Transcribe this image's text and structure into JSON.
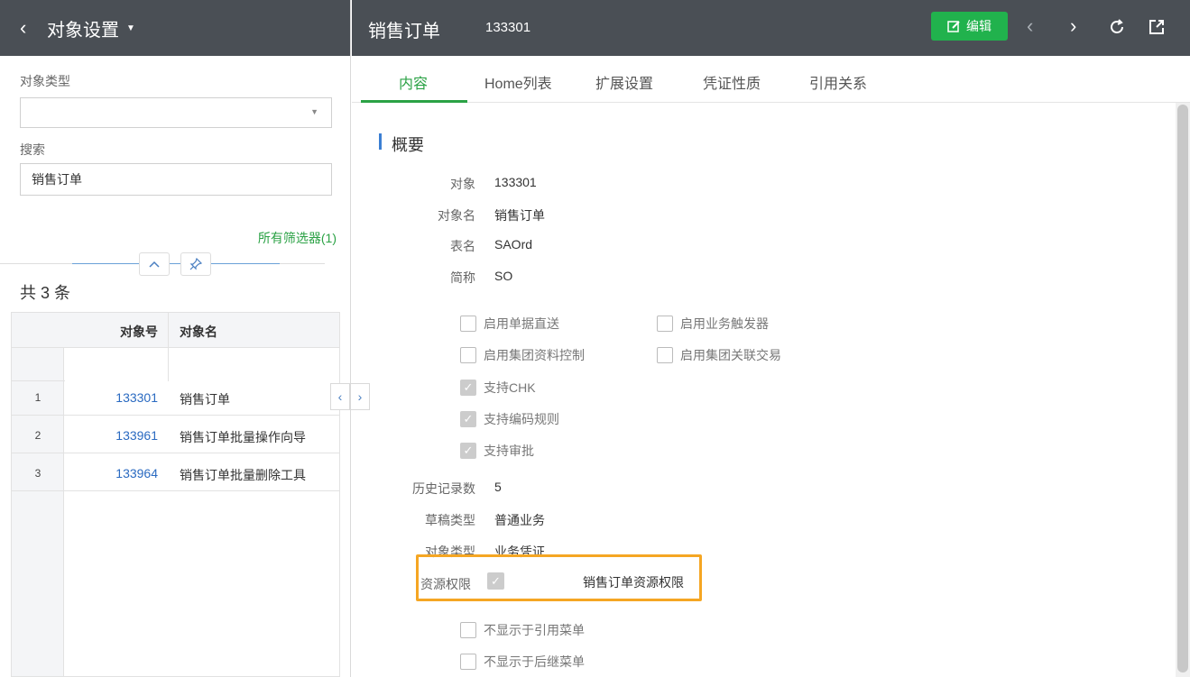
{
  "left": {
    "header_title": "对象设置",
    "object_type_label": "对象类型",
    "object_type_value": "",
    "search_label": "搜索",
    "search_value": "销售订单",
    "filters_link": "所有筛选器(1)",
    "count_text": "共 3 条",
    "grid": {
      "col_code": "对象号",
      "col_name": "对象名",
      "rows": [
        {
          "idx": "1",
          "code": "133301",
          "name": "销售订单"
        },
        {
          "idx": "2",
          "code": "133961",
          "name": "销售订单批量操作向导"
        },
        {
          "idx": "3",
          "code": "133964",
          "name": "销售订单批量删除工具"
        }
      ]
    }
  },
  "right": {
    "title": "销售订单",
    "number": "133301",
    "edit_label": "编辑",
    "tabs": [
      "内容",
      "Home列表",
      "扩展设置",
      "凭证性质",
      "引用关系"
    ],
    "section_title": "概要",
    "fields": {
      "object_label": "对象",
      "object_value": "133301",
      "object_name_label": "对象名",
      "object_name_value": "销售订单",
      "table_label": "表名",
      "table_value": "SAOrd",
      "abbr_label": "简称",
      "abbr_value": "SO"
    },
    "checkboxes": {
      "doc_direct": "启用单据直送",
      "biz_trigger": "启用业务触发器",
      "group_data_ctrl": "启用集团资料控制",
      "group_related": "启用集团关联交易",
      "support_chk": "支持CHK",
      "support_code_rule": "支持编码规则",
      "support_approval": "支持审批",
      "hide_ref_menu": "不显示于引用菜单",
      "hide_next_menu": "不显示于后继菜单"
    },
    "fields2": {
      "history_label": "历史记录数",
      "history_value": "5",
      "draft_label": "草稿类型",
      "draft_value": "普通业务",
      "objtype_label": "对象类型",
      "objtype_value": "业务凭证",
      "perm_label": "资源权限",
      "perm_value": "销售订单资源权限"
    }
  },
  "colors": {
    "header_bg": "#4a4f55",
    "accent_green": "#2ba245",
    "link_blue": "#2a6ac1",
    "highlight_orange": "#f5a623"
  }
}
